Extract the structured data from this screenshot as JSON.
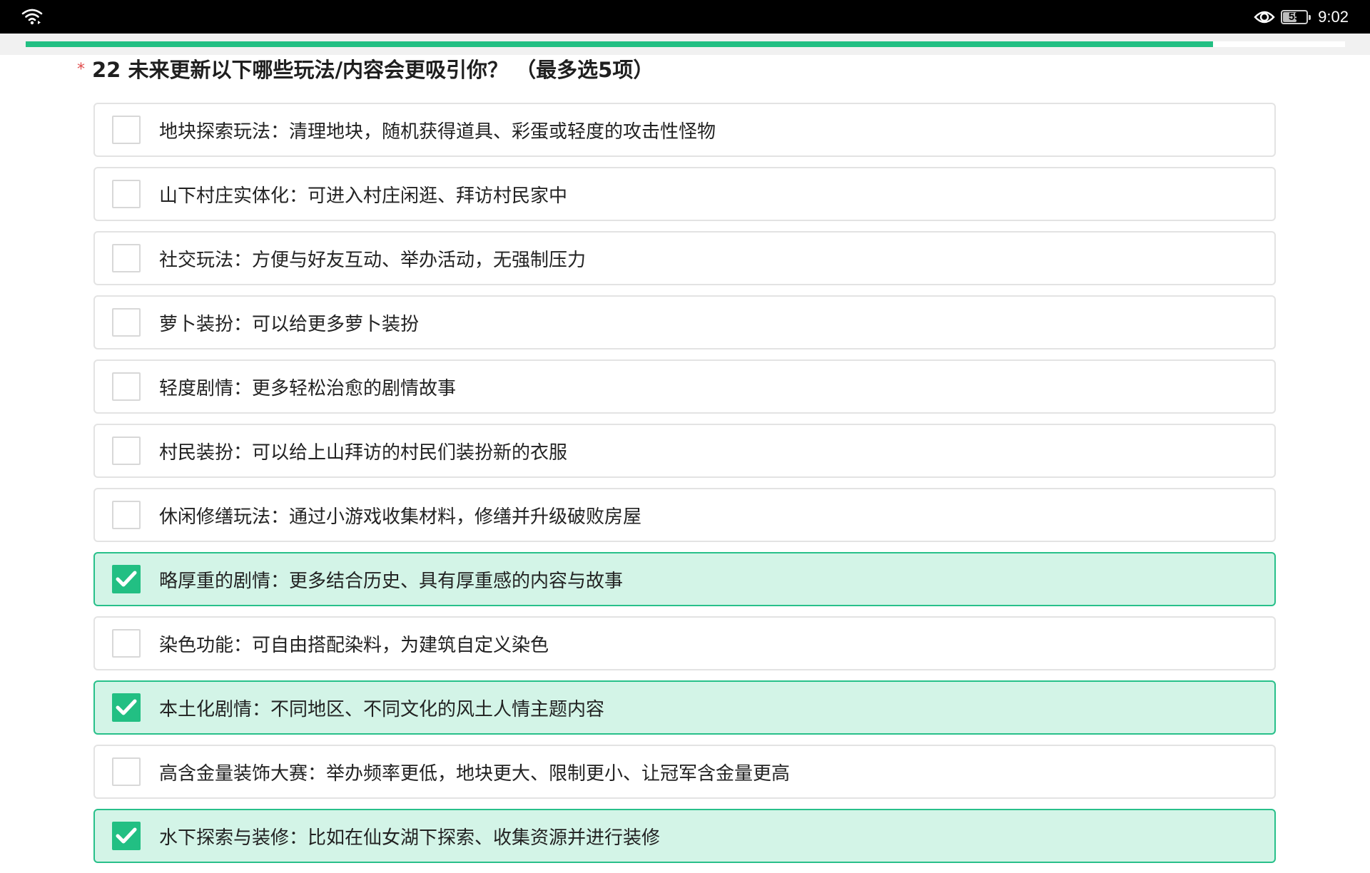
{
  "status_bar": {
    "time": "9:02",
    "battery_level": "55",
    "battery_percent": 55,
    "icons": [
      "wifi-icon",
      "eye-icon",
      "battery-icon"
    ]
  },
  "progress": {
    "fraction": 0.9
  },
  "question": {
    "required_mark": "*",
    "title": "22 未来更新以下哪些玩法/内容会更吸引你？ （最多选5项）"
  },
  "options": [
    {
      "label": "地块探索玩法：清理地块，随机获得道具、彩蛋或轻度的攻击性怪物",
      "selected": false
    },
    {
      "label": "山下村庄实体化：可进入村庄闲逛、拜访村民家中",
      "selected": false
    },
    {
      "label": "社交玩法：方便与好友互动、举办活动，无强制压力",
      "selected": false
    },
    {
      "label": "萝卜装扮：可以给更多萝卜装扮",
      "selected": false
    },
    {
      "label": "轻度剧情：更多轻松治愈的剧情故事",
      "selected": false
    },
    {
      "label": "村民装扮：可以给上山拜访的村民们装扮新的衣服",
      "selected": false
    },
    {
      "label": "休闲修缮玩法：通过小游戏收集材料，修缮并升级破败房屋",
      "selected": false
    },
    {
      "label": "略厚重的剧情：更多结合历史、具有厚重感的内容与故事",
      "selected": true
    },
    {
      "label": "染色功能：可自由搭配染料，为建筑自定义染色",
      "selected": false
    },
    {
      "label": "本土化剧情：不同地区、不同文化的风土人情主题内容",
      "selected": true
    },
    {
      "label": "高含金量装饰大赛：举办频率更低，地块更大、限制更小、让冠军含金量更高",
      "selected": false
    },
    {
      "label": "水下探索与装修：比如在仙女湖下探索、收集资源并进行装修",
      "selected": true
    }
  ],
  "colors": {
    "accent": "#22bf83",
    "selected_bg": "#d3f4e7",
    "required": "#e04d4d"
  }
}
